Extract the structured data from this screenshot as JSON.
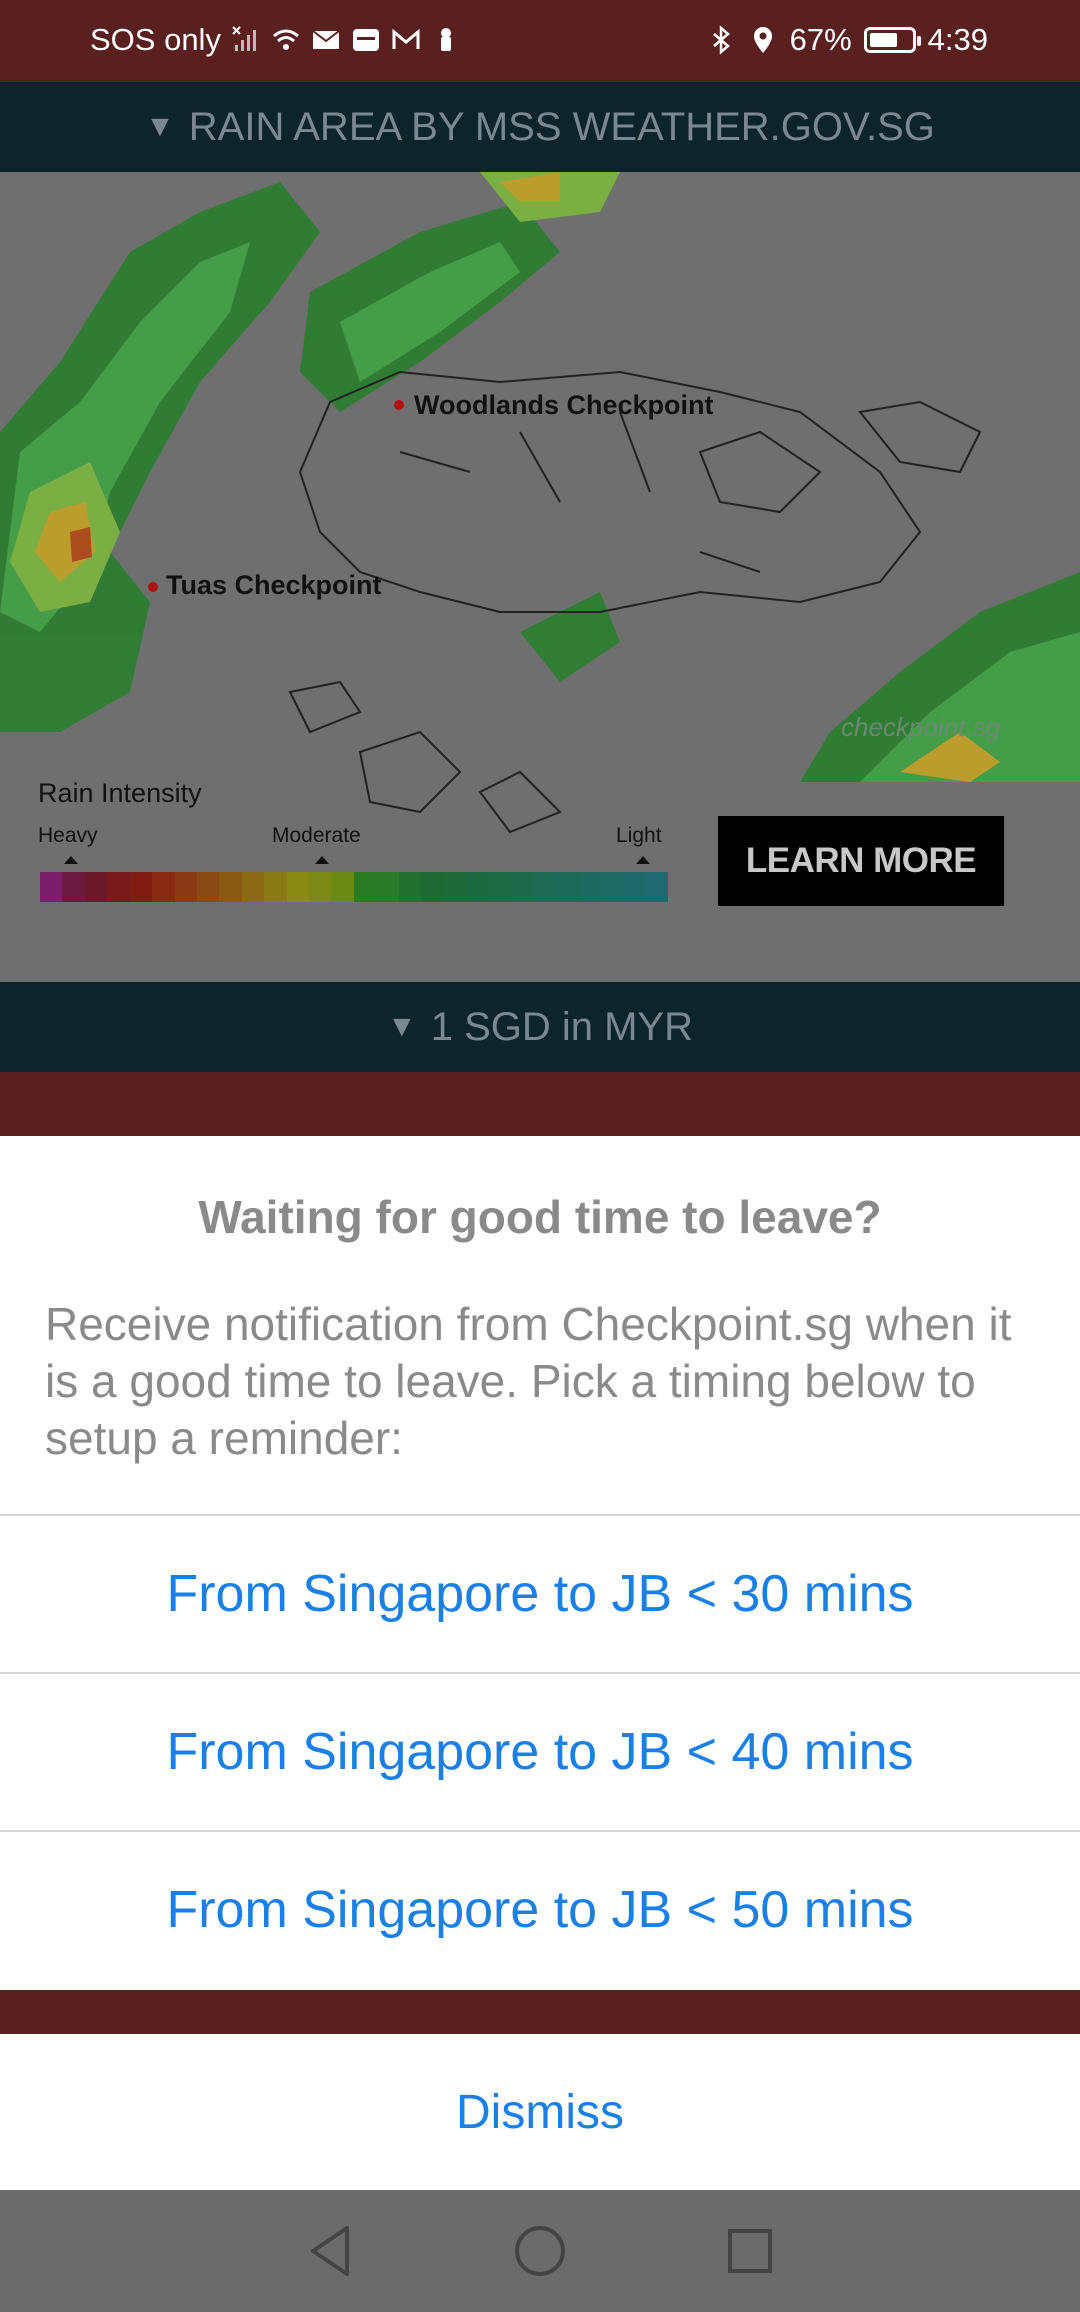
{
  "status_bar": {
    "carrier": "SOS only",
    "battery": "67%",
    "time": "4:39",
    "icons_left": [
      "signal-icon",
      "wifi-icon",
      "mail-icon",
      "app-icon",
      "gmail-icon",
      "notification-icon"
    ],
    "icons_right": [
      "bluetooth-icon",
      "location-icon",
      "battery-icon"
    ],
    "battery_level": 0.67
  },
  "rain_section": {
    "header": "RAIN AREA BY MSS WEATHER.GOV.SG",
    "map_labels": {
      "woodlands": "Woodlands Checkpoint",
      "tuas": "Tuas Checkpoint"
    },
    "watermark": "checkpoint.sg",
    "legend": {
      "title": "Rain Intensity",
      "heavy": "Heavy",
      "moderate": "Moderate",
      "light": "Light"
    },
    "learn_more": "LEARN MORE"
  },
  "currency_section": {
    "header": "1 SGD in MYR"
  },
  "action_sheet": {
    "title": "Waiting for good time to leave?",
    "message": "Receive notification from Checkpoint.sg when it is a good time to leave. Pick a timing below to setup a reminder:",
    "options": [
      "From Singapore to JB < 30 mins",
      "From Singapore to JB < 40 mins",
      "From Singapore to JB < 50 mins"
    ],
    "dismiss": "Dismiss"
  },
  "nav_bar": {
    "buttons": [
      "back-icon",
      "home-icon",
      "recents-icon"
    ]
  },
  "colors": {
    "status_bar_bg": "#5a1f1f",
    "section_bar_bg": "#0e242b",
    "action_text": "#1a80e6",
    "muted_text": "#8a8a8a"
  }
}
